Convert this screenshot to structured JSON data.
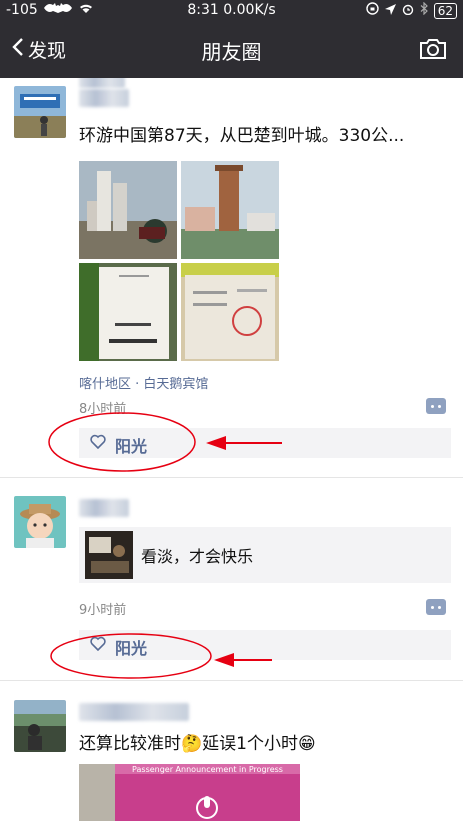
{
  "status_bar": {
    "signal": "-105",
    "time": "8:31",
    "speed": "0.00K/s",
    "battery": "62"
  },
  "nav": {
    "back_label": "发现",
    "title": "朋友圈"
  },
  "posts": [
    {
      "text": "环游中国第87天，从巴楚到叶城。330公...",
      "location": "喀什地区 · 白天鹅宾馆",
      "time": "8小时前",
      "likes": "阳光"
    },
    {
      "share_text": "看淡，才会快乐",
      "time": "9小时前",
      "likes": "阳光"
    },
    {
      "text": "还算比较准时🤔延误1个小时😁",
      "image_caption": "Passenger Announcement in Progress"
    }
  ],
  "annotation_color": "#e60012"
}
